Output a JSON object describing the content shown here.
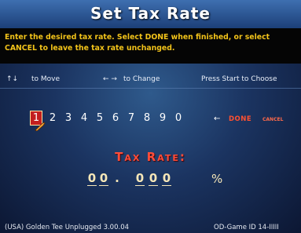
{
  "title": "Set Tax Rate",
  "instructions": "Enter the desired tax rate.  Select DONE when finished, or select CANCEL to leave the tax rate unchanged.",
  "hints": {
    "move_arrows": "↑↓",
    "move": "to Move",
    "change_arrows": "← →",
    "change": "to Change",
    "start": "Press Start to Choose"
  },
  "keypad": {
    "digits": [
      "1",
      "2",
      "3",
      "4",
      "5",
      "6",
      "7",
      "8",
      "9",
      "0"
    ],
    "selected_index": 0,
    "back_arrow": "←",
    "done": "DONE",
    "cancel": "CANCEL"
  },
  "tax_rate": {
    "label": "Tax Rate:",
    "digits": [
      "0",
      "0",
      ".",
      "0",
      "0",
      "0"
    ],
    "unit": "%"
  },
  "footer": {
    "left": "(USA) Golden Tee Unplugged 3.00.04",
    "right": "OD-Game ID 14-IIIII"
  },
  "colors": {
    "accent_yellow": "#f2c31a",
    "accent_red": "#ff4d3a",
    "selection_red": "#c21f1f"
  }
}
